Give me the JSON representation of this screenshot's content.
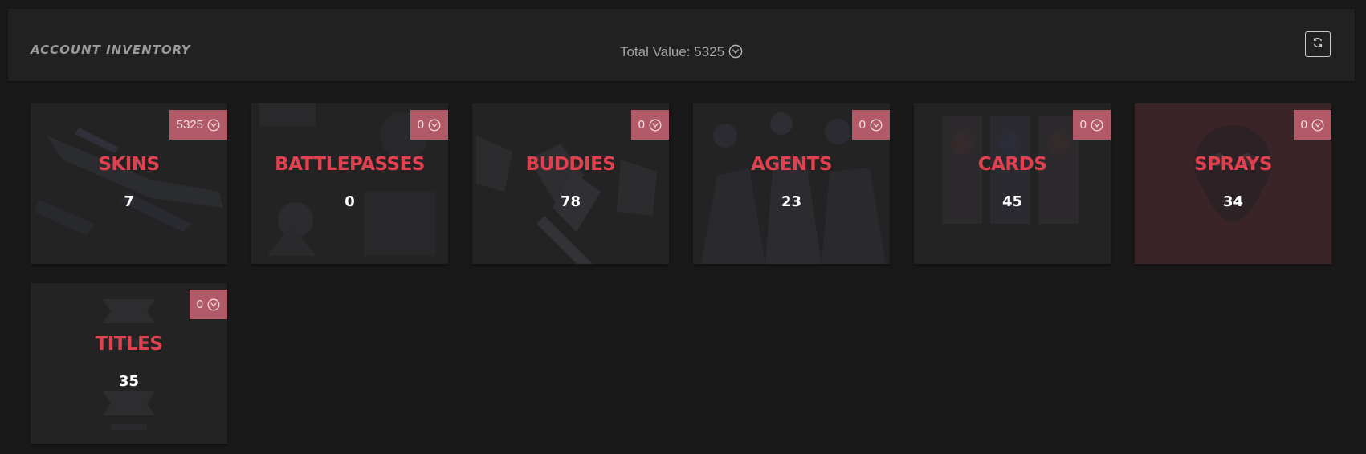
{
  "header": {
    "title": "ACCOUNT INVENTORY",
    "total_value_label": "Total Value: 5325",
    "currency_icon": "valorant-points-icon",
    "refresh_icon": "refresh-icon"
  },
  "colors": {
    "background": "#1a191a",
    "panel": "#212122",
    "tile": "#242324",
    "tile_active": "#3a2428",
    "badge": "#b35a68",
    "label": "#e0414f",
    "count": "#ffffff"
  },
  "categories": [
    {
      "label": "SKINS",
      "count": "7",
      "value": "5325"
    },
    {
      "label": "BATTLEPASSES",
      "count": "0",
      "value": "0"
    },
    {
      "label": "BUDDIES",
      "count": "78",
      "value": "0"
    },
    {
      "label": "AGENTS",
      "count": "23",
      "value": "0"
    },
    {
      "label": "CARDS",
      "count": "45",
      "value": "0"
    },
    {
      "label": "SPRAYS",
      "count": "34",
      "value": "0"
    },
    {
      "label": "TITLES",
      "count": "35",
      "value": "0"
    }
  ]
}
